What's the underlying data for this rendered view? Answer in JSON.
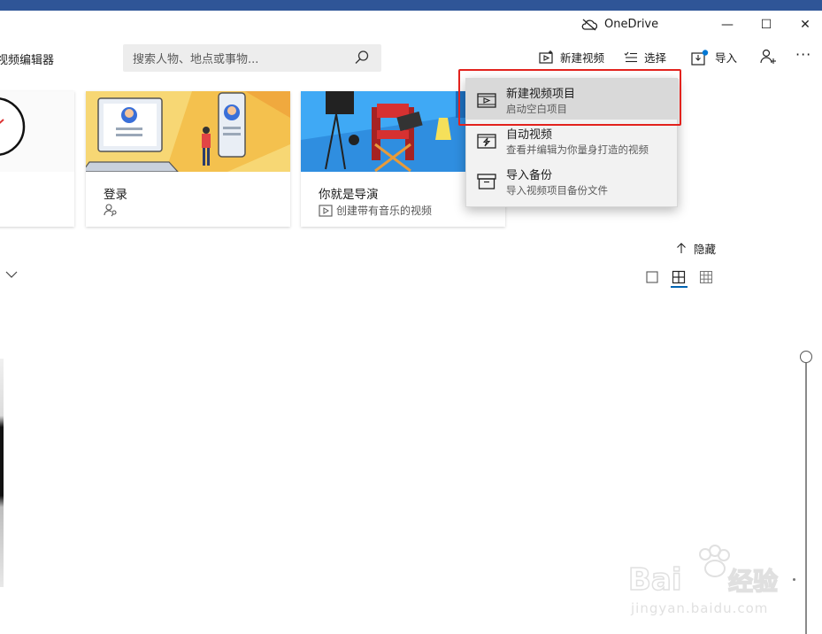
{
  "titlebar": {
    "onedrive_label": "OneDrive",
    "minimize_glyph": "—",
    "maximize_glyph": "☐",
    "close_glyph": "✕"
  },
  "app": {
    "title": "视频编辑器"
  },
  "search": {
    "placeholder": "搜索人物、地点或事物..."
  },
  "toolbar": {
    "new_video": "新建视频",
    "select": "选择",
    "import": "导入",
    "more": "···"
  },
  "cards": [
    {
      "title": "",
      "subtitle": ""
    },
    {
      "title": "登录",
      "subtitle": ""
    },
    {
      "title": "你就是导演",
      "subtitle": "创建带有音乐的视频"
    }
  ],
  "menu": {
    "items": [
      {
        "title": "新建视频项目",
        "subtitle": "启动空白项目",
        "icon": "video-project-icon"
      },
      {
        "title": "自动视频",
        "subtitle": "查看并编辑为你量身打造的视频",
        "icon": "auto-video-icon"
      },
      {
        "title": "导入备份",
        "subtitle": "导入视频项目备份文件",
        "icon": "archive-icon"
      }
    ]
  },
  "section": {
    "hide_label": "隐藏"
  },
  "colors": {
    "accent": "#0063b1",
    "highlight_border": "#e2221d",
    "titlebar_strip": "#2f5597"
  },
  "watermark": {
    "brand": "Baidu经验",
    "url": "jingyan.baidu.com"
  }
}
